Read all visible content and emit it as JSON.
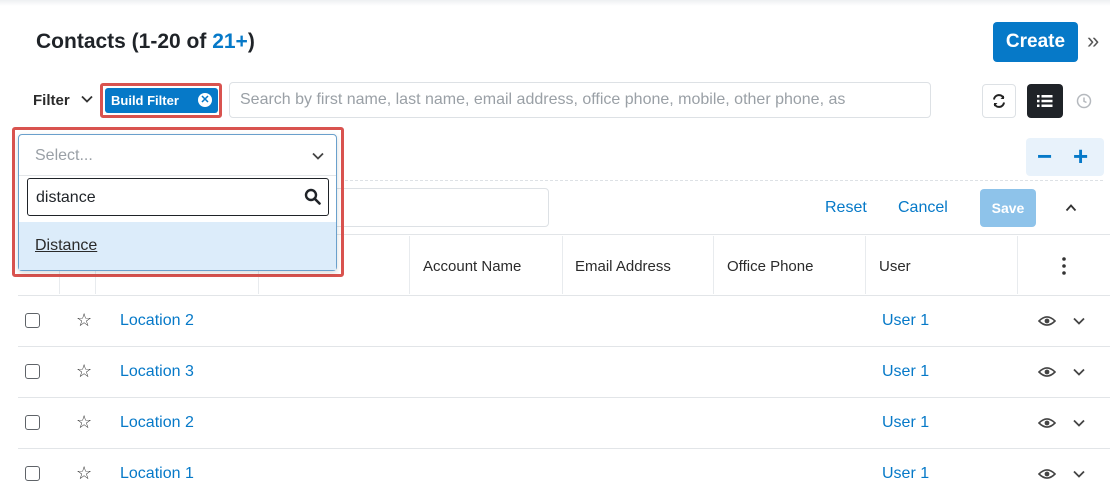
{
  "header": {
    "title_prefix": "Contacts (1-20 of ",
    "title_count": "21+",
    "title_suffix": ")",
    "create_label": "Create",
    "expand_icon": "double-chevron-right-icon"
  },
  "filter": {
    "label": "Filter",
    "build_filter_label": "Build Filter",
    "search_placeholder": "Search by first name, last name, email address, office phone, mobile, other phone, as"
  },
  "filter_row": {
    "reset_label": "Reset",
    "cancel_label": "Cancel",
    "save_label": "Save"
  },
  "dropdown": {
    "select_placeholder": "Select...",
    "search_value": "distance",
    "options": [
      "Distance"
    ]
  },
  "table": {
    "columns": [
      "Account Name",
      "Email Address",
      "Office Phone",
      "User"
    ],
    "rows": [
      {
        "name": "Location 2",
        "user": "User 1"
      },
      {
        "name": "Location 3",
        "user": "User 1"
      },
      {
        "name": "Location 2",
        "user": "User 1"
      },
      {
        "name": "Location 1",
        "user": "User 1"
      }
    ]
  },
  "colors": {
    "accent": "#0679c8",
    "highlight": "#d9534f",
    "option_bg": "#dcecfa",
    "save_disabled": "#8ec3ea"
  }
}
